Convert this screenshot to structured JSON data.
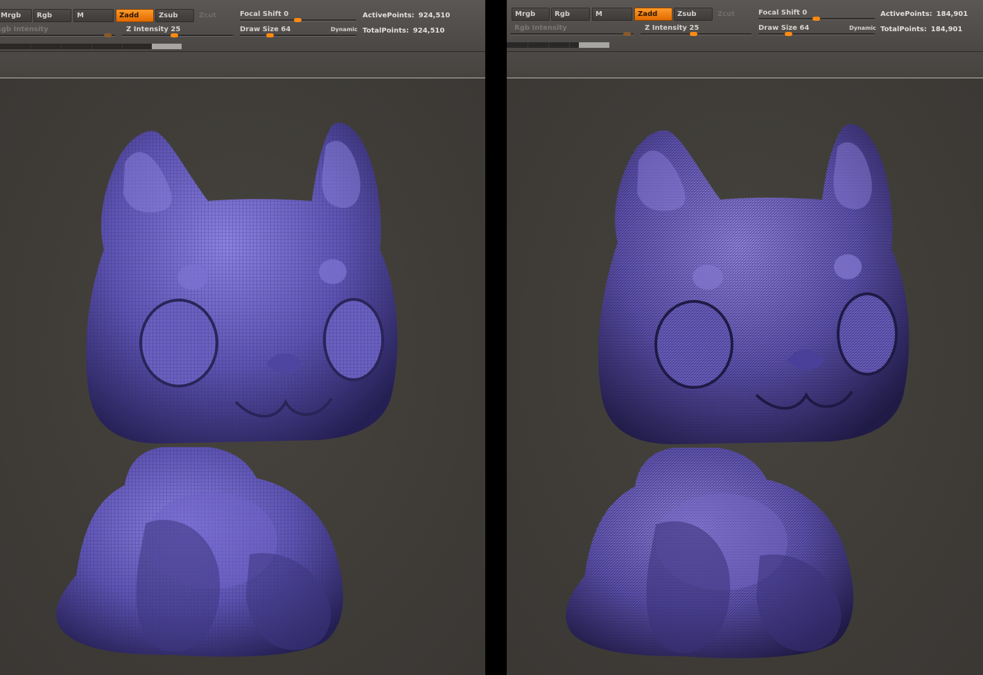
{
  "colors": {
    "accent": "#ff8a10",
    "viewport_bg": "#3f3c3a",
    "mesh_fill_left": "#6f63c8",
    "mesh_fill_right": "#7566c6",
    "mesh_line": "#2a2458"
  },
  "panels": [
    {
      "buttons": {
        "mrgb": "Mrgb",
        "rgb": "Rgb",
        "m": "M",
        "zadd": "Zadd",
        "zsub": "Zsub",
        "zcut": "Zcut"
      },
      "rgb_intensity_label": "Rgb Intensity",
      "z_intensity_label": "Z Intensity",
      "z_intensity_value": "25",
      "focal_shift_label": "Focal Shift",
      "focal_shift_value": "0",
      "draw_size_label": "Draw Size",
      "draw_size_value": "64",
      "dynamic_label": "Dynamic",
      "active_points_label": "ActivePoints:",
      "active_points_value": "924,510",
      "total_points_label": "TotalPoints:",
      "total_points_value": "924,510",
      "model_icon": "cat-figurine-quad-mesh"
    },
    {
      "buttons": {
        "mrgb": "Mrgb",
        "rgb": "Rgb",
        "m": "M",
        "zadd": "Zadd",
        "zsub": "Zsub",
        "zcut": "Zcut"
      },
      "rgb_intensity_label": "Rgb Intensity",
      "z_intensity_label": "Z Intensity",
      "z_intensity_value": "25",
      "focal_shift_label": "Focal Shift",
      "focal_shift_value": "0",
      "draw_size_label": "Draw Size",
      "draw_size_value": "64",
      "dynamic_label": "Dynamic",
      "active_points_label": "ActivePoints:",
      "active_points_value": "184,901",
      "total_points_label": "TotalPoints:",
      "total_points_value": "184,901",
      "model_icon": "cat-figurine-triangle-mesh"
    }
  ]
}
